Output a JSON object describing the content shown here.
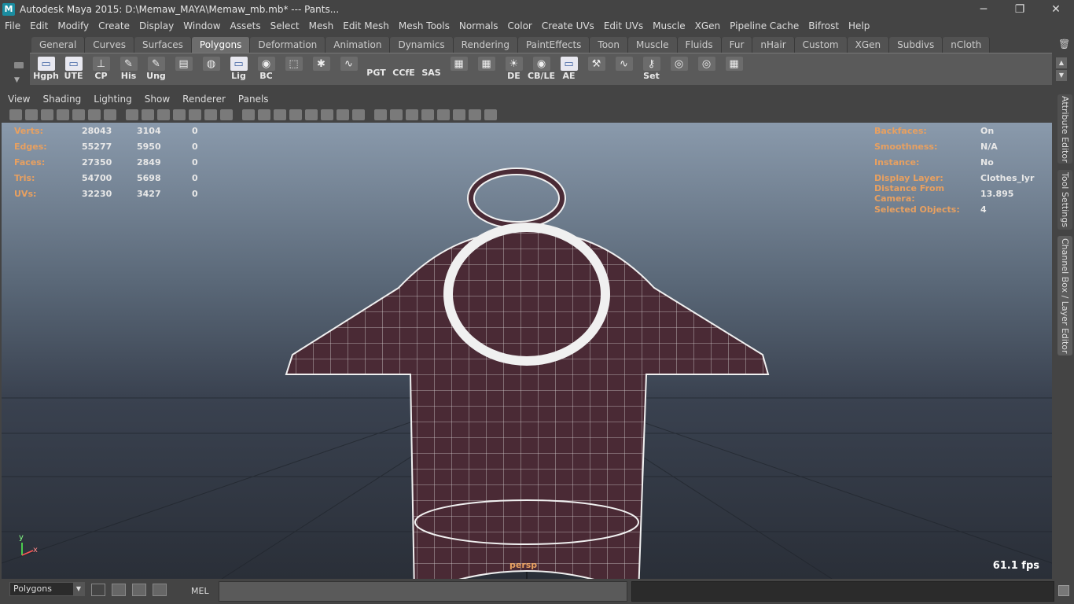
{
  "window": {
    "title": "Autodesk Maya 2015: D:\\Memaw_MAYA\\Memaw_mb.mb*   ---   Pants...",
    "minimize": "─",
    "maximize": "❐",
    "close": "✕"
  },
  "menubar": [
    "File",
    "Edit",
    "Modify",
    "Create",
    "Display",
    "Window",
    "Assets",
    "Select",
    "Mesh",
    "Edit Mesh",
    "Mesh Tools",
    "Normals",
    "Color",
    "Create UVs",
    "Edit UVs",
    "Muscle",
    "XGen",
    "Pipeline Cache",
    "Bifrost",
    "Help"
  ],
  "shelf_tabs": [
    "General",
    "Curves",
    "Surfaces",
    "Polygons",
    "Deformation",
    "Animation",
    "Dynamics",
    "Rendering",
    "PaintEffects",
    "Toon",
    "Muscle",
    "Fluids",
    "Fur",
    "nHair",
    "Custom",
    "XGen",
    "Subdivs",
    "nCloth"
  ],
  "shelf_tab_active": "Polygons",
  "shelf_buttons": [
    {
      "label": "Hgph",
      "icon": "window-icon"
    },
    {
      "label": "UTE",
      "icon": "window-icon"
    },
    {
      "label": "CP",
      "icon": "axis-icon"
    },
    {
      "label": "His",
      "icon": "edit-icon"
    },
    {
      "label": "Ung",
      "icon": "edit-icon"
    },
    {
      "label": "",
      "icon": "layers-icon"
    },
    {
      "label": "",
      "icon": "globe-icon"
    },
    {
      "label": "Lig",
      "icon": "window-icon"
    },
    {
      "label": "BC",
      "icon": "eye-icon"
    },
    {
      "label": "",
      "icon": "cube-icon"
    },
    {
      "label": "",
      "icon": "gear-icon"
    },
    {
      "label": "",
      "icon": "curve-icon"
    },
    {
      "label": "PGT",
      "icon": ""
    },
    {
      "label": "CCfE",
      "icon": ""
    },
    {
      "label": "SAS",
      "icon": ""
    },
    {
      "label": "",
      "icon": "uv-icon"
    },
    {
      "label": "",
      "icon": "uv-icon"
    },
    {
      "label": "DE",
      "icon": "light-icon"
    },
    {
      "label": "CB/LE",
      "icon": "eye-icon"
    },
    {
      "label": "AE",
      "icon": "window-icon"
    },
    {
      "label": "",
      "icon": "tool-icon"
    },
    {
      "label": "",
      "icon": "curve-icon"
    },
    {
      "label": "Set",
      "icon": "key-icon"
    },
    {
      "label": "",
      "icon": "target-icon"
    },
    {
      "label": "",
      "icon": "target-icon"
    },
    {
      "label": "",
      "icon": "uv-icon"
    }
  ],
  "panel_menu": [
    "View",
    "Shading",
    "Lighting",
    "Show",
    "Renderer",
    "Panels"
  ],
  "hud_left": [
    {
      "key": "Verts:",
      "v1": "28043",
      "v2": "3104",
      "v3": "0"
    },
    {
      "key": "Edges:",
      "v1": "55277",
      "v2": "5950",
      "v3": "0"
    },
    {
      "key": "Faces:",
      "v1": "27350",
      "v2": "2849",
      "v3": "0"
    },
    {
      "key": "Tris:",
      "v1": "54700",
      "v2": "5698",
      "v3": "0"
    },
    {
      "key": "UVs:",
      "v1": "32230",
      "v2": "3427",
      "v3": "0"
    }
  ],
  "hud_right": [
    {
      "key": "Backfaces:",
      "value": "On"
    },
    {
      "key": "Smoothness:",
      "value": "N/A"
    },
    {
      "key": "Instance:",
      "value": "No"
    },
    {
      "key": "Display Layer:",
      "value": "Clothes_lyr"
    },
    {
      "key": "Distance From Camera:",
      "value": "13.895"
    },
    {
      "key": "Selected Objects:",
      "value": "4"
    }
  ],
  "camera": "persp",
  "fps": "61.1 fps",
  "axis": {
    "y": "y",
    "x": "x"
  },
  "side_tabs": [
    "Attribute Editor",
    "Tool Settings",
    "Channel Box / Layer Editor"
  ],
  "mode_select": "Polygons",
  "mel_label": "MEL",
  "colors": {
    "hud_key": "#e8a060",
    "cloth": "#4a2a35",
    "wire": "#ffffff"
  }
}
